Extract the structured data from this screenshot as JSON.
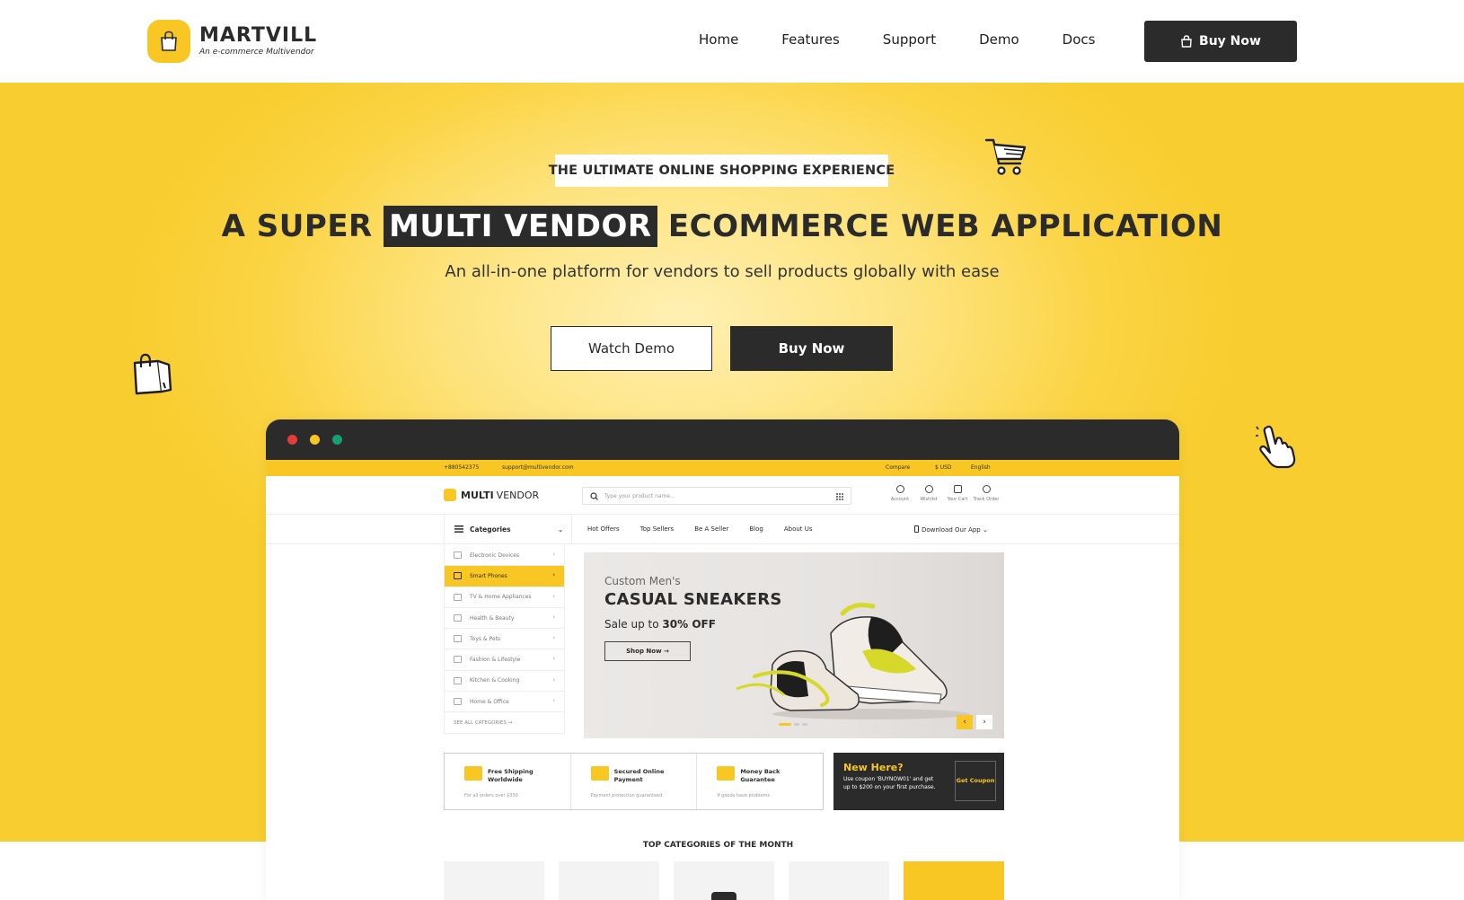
{
  "brand": {
    "name": "MARTVILL",
    "tagline": "An e-commerce Multivendor",
    "accent": "#f9c723",
    "dark": "#2b2b2b"
  },
  "nav": {
    "links": [
      "Home",
      "Features",
      "Support",
      "Demo",
      "Docs"
    ],
    "buy_label": "Buy Now"
  },
  "hero": {
    "eyebrow": "THE ULTIMATE ONLINE SHOPPING EXPERIENCE",
    "headline_pre": "A SUPER",
    "headline_highlight": "MULTI VENDOR",
    "headline_post": "ECOMMERCE WEB APPLICATION",
    "subline": "An all-in-one platform for vendors to sell products globally with ease",
    "watch_label": "Watch Demo",
    "buy_label": "Buy Now"
  },
  "preview": {
    "topbar": {
      "phone": "+880542375",
      "email": "support@multivendor.com",
      "compare": "Compare",
      "currency": "$ USD",
      "language": "English"
    },
    "logo_bold": "MULTI",
    "logo_light": "VENDOR",
    "search_placeholder": "Type your product name...",
    "header_icons": [
      "Account",
      "Wishlist",
      "Your Cart",
      "Track Order"
    ],
    "categories_label": "Categories",
    "menu": [
      "Hot Offers",
      "Top Sellers",
      "Be A Seller",
      "Blog",
      "About Us"
    ],
    "download_app": "Download Our App",
    "categories": [
      "Electronic Devices",
      "Smart Phones",
      "TV & Home Appliances",
      "Health & Beauty",
      "Toys & Pets",
      "Fashion & Lifestyle",
      "Kitchen & Cooking",
      "Home & Office"
    ],
    "see_all": "SEE ALL CATEGORIES →",
    "banner": {
      "subtitle": "Custom Men's",
      "title": "CASUAL SNEAKERS",
      "sale_pre": "Sale up to",
      "sale_value": "30% OFF",
      "cta": "Shop Now →"
    },
    "features": [
      {
        "title": "Free Shipping Worldwide",
        "sub": "For all orders over $350"
      },
      {
        "title": "Secured Online Payment",
        "sub": "Payment protection guaranteed"
      },
      {
        "title": "Money Back Guarantee",
        "sub": "If goods have problems"
      }
    ],
    "coupon": {
      "title": "New Here?",
      "text": "Use coupon 'BUYNOW01' and get up to $200 on your first purchase.",
      "button": "Get Coupon"
    },
    "top_categories": "TOP CATEGORIES OF THE MONTH"
  }
}
